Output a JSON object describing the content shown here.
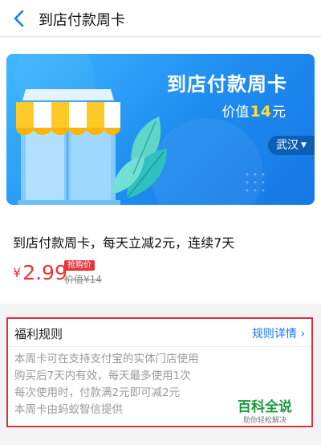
{
  "header": {
    "title": "到店付款周卡"
  },
  "banner": {
    "title": "到店付款周卡",
    "value_prefix": "价值",
    "value_num": "14",
    "value_suffix": "元",
    "city": "武汉"
  },
  "product": {
    "title": "到店付款周卡，每天立减2元，连续7天",
    "price_symbol": "¥",
    "price": "2.99",
    "badge": "抢购价",
    "original_price": "价值¥14"
  },
  "rules": {
    "heading": "福利规则",
    "detail_link": "规则详情",
    "items": [
      "本周卡可在支持支付宝的实体门店使用",
      "购买后7天内有效，每天最多使用1次",
      "每次使用时，付款满2元即可减2元",
      "本周卡由蚂蚁智信提供"
    ]
  },
  "watermark": {
    "main": "百科全说",
    "sub": "助你轻松解决"
  },
  "colors": {
    "accent_blue": "#1677ff",
    "price_red": "#e5363a",
    "banner_blue": "#1e8cf0"
  }
}
